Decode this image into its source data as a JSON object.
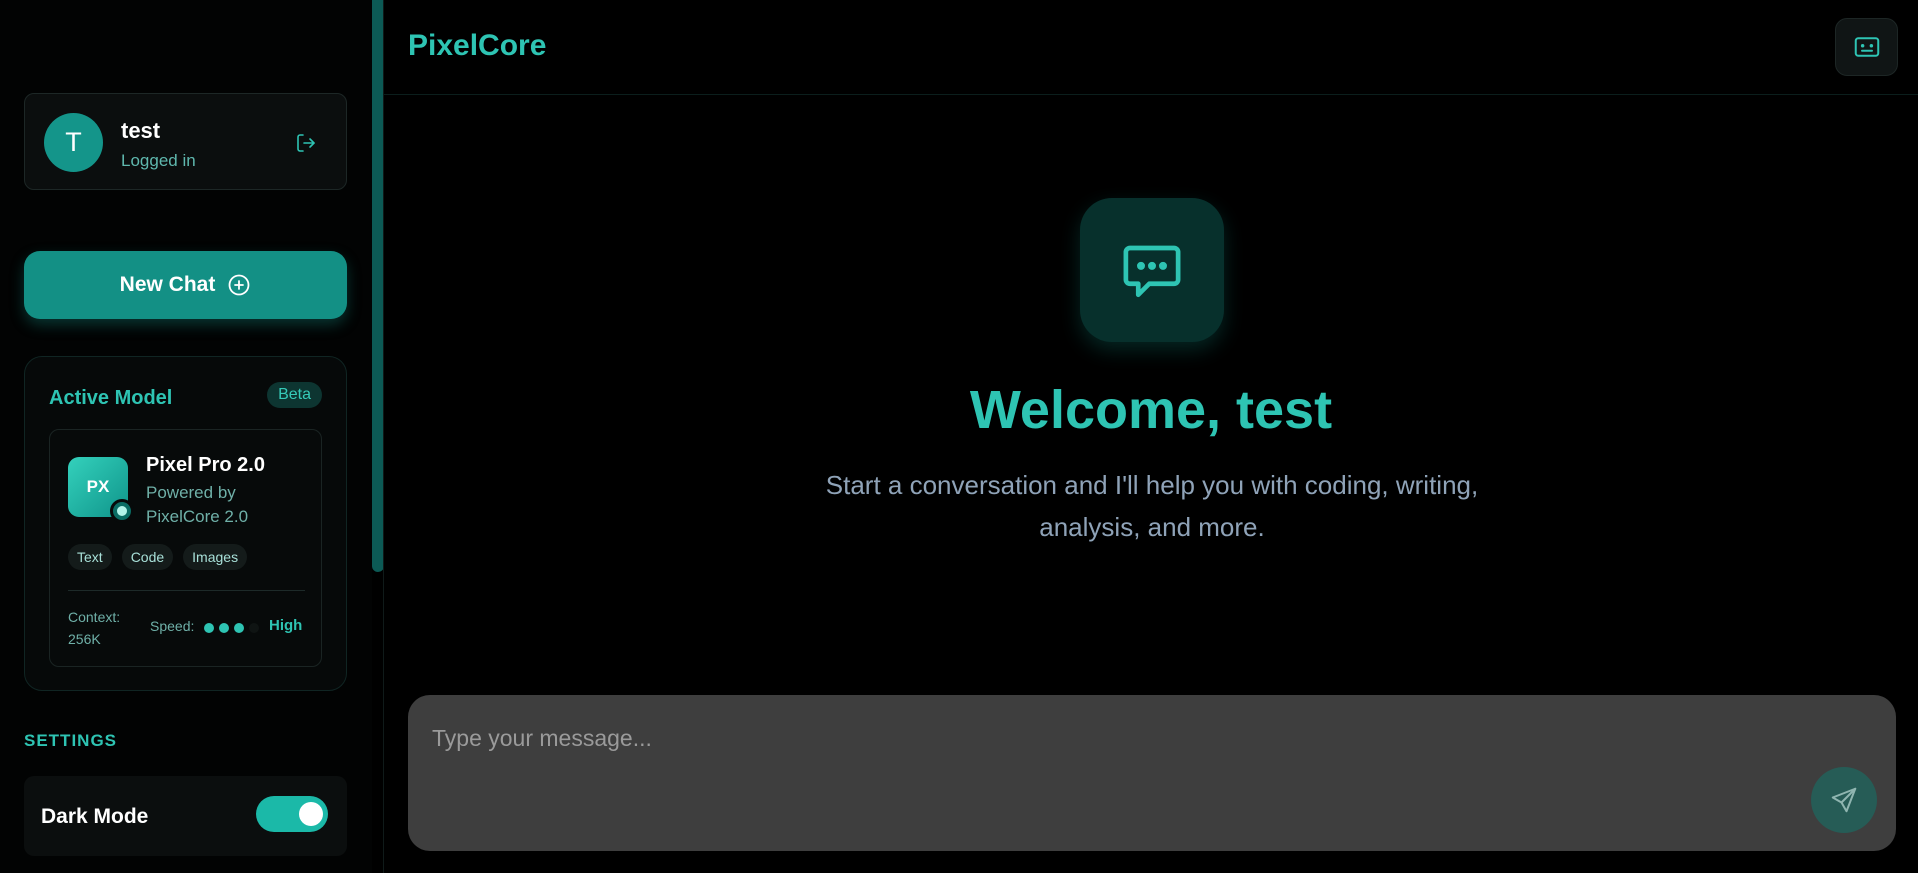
{
  "app": {
    "brand": "PixelCore"
  },
  "user": {
    "avatar_initial": "T",
    "name": "test",
    "status": "Logged in"
  },
  "sidebar": {
    "new_chat_label": "New Chat",
    "active_model": {
      "title": "Active Model",
      "badge": "Beta",
      "logo_text": "PX",
      "name": "Pixel Pro 2.0",
      "powered_by": "Powered by PixelCore 2.0",
      "tags": [
        "Text",
        "Code",
        "Images"
      ],
      "context_label": "Context: 256K",
      "speed_label": "Speed:",
      "speed_level": 3,
      "speed_max": 4,
      "speed_value": "High"
    },
    "settings": {
      "heading": "SETTINGS",
      "dark_mode_label": "Dark Mode",
      "dark_mode_on": true
    }
  },
  "main": {
    "welcome_title": "Welcome, test",
    "welcome_subtitle": "Start a conversation and I'll help you with coding, writing, analysis, and more.",
    "composer_placeholder": "Type your message..."
  },
  "colors": {
    "accent": "#2ec4b3",
    "button": "#139085",
    "background": "#000000"
  },
  "icons": {
    "logout": "logout-icon",
    "new_chat": "plus-circle-icon",
    "chat": "chat-bubble-icon",
    "panel": "sidebar-toggle-icon",
    "send": "send-icon"
  }
}
